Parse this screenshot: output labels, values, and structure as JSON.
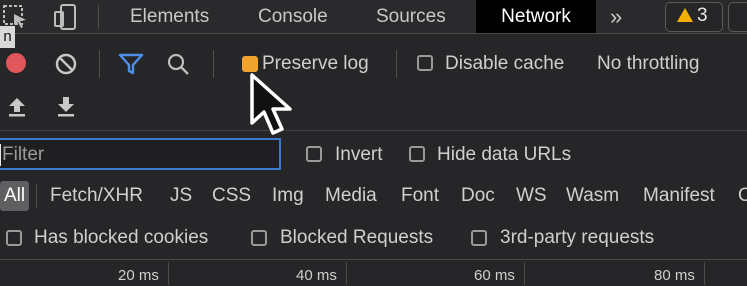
{
  "tabs": {
    "elements": "Elements",
    "console": "Console",
    "sources": "Sources",
    "network": "Network",
    "more": "»"
  },
  "badges": {
    "warnings": "3"
  },
  "tooltip": {
    "text": "n"
  },
  "toolbar": {
    "preserve_log": "Preserve log",
    "disable_cache": "Disable cache",
    "throttling": "No throttling"
  },
  "filter": {
    "placeholder": "Filter",
    "invert": "Invert",
    "hide_data_urls": "Hide data URLs"
  },
  "type_filters": [
    "All",
    "Fetch/XHR",
    "JS",
    "CSS",
    "Img",
    "Media",
    "Font",
    "Doc",
    "WS",
    "Wasm",
    "Manifest",
    "O"
  ],
  "options": {
    "has_blocked_cookies": "Has blocked cookies",
    "blocked_requests": "Blocked Requests",
    "third_party": "3rd-party requests"
  },
  "timeline": [
    "20 ms",
    "40 ms",
    "60 ms",
    "80 ms"
  ],
  "colors": {
    "accent_blue": "#3b78d4",
    "record_red": "#e0575b",
    "checkbox_orange": "#f2a32c",
    "warning_yellow": "#f6b100"
  }
}
